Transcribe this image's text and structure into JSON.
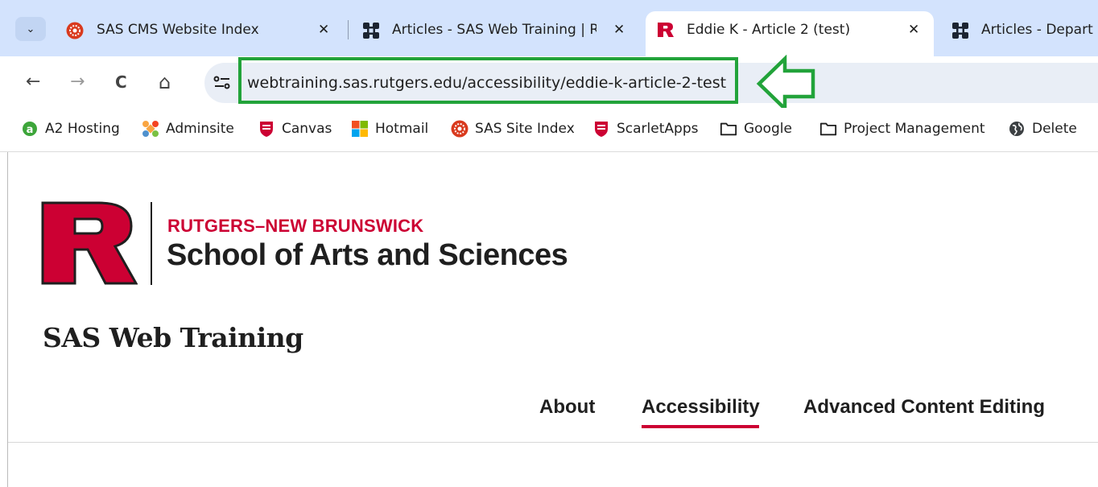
{
  "browser": {
    "tabs": [
      {
        "title": "SAS CMS Website Index",
        "icon": "sas-logo-icon",
        "close": "✕"
      },
      {
        "title": "Articles - SAS Web Training | Ru",
        "icon": "joomla-icon",
        "close": "✕"
      },
      {
        "title": "Eddie K - Article 2 (test)",
        "icon": "rutgers-r-icon",
        "close": "✕",
        "active": true
      },
      {
        "title": "Articles - Depart",
        "icon": "joomla-icon"
      }
    ],
    "tab_dropdown": "⌄",
    "nav": {
      "back": "←",
      "forward": "→",
      "reload": "C",
      "home": "⌂"
    },
    "url": "webtraining.sas.rutgers.edu/accessibility/eddie-k-article-2-test",
    "annotation_color": "#22a33a",
    "bookmarks": [
      {
        "label": "A2 Hosting",
        "icon": "a2-hosting-icon"
      },
      {
        "label": "Adminsite",
        "icon": "joomla-icon"
      },
      {
        "label": "Canvas",
        "icon": "rutgers-shield-icon"
      },
      {
        "label": "Hotmail",
        "icon": "windows-icon"
      },
      {
        "label": "SAS Site Index",
        "icon": "sas-logo-icon"
      },
      {
        "label": "ScarletApps",
        "icon": "rutgers-shield-icon"
      },
      {
        "label": "Google",
        "icon": "folder-icon"
      },
      {
        "label": "Project Management",
        "icon": "folder-icon"
      },
      {
        "label": "Delete",
        "icon": "globe-icon"
      }
    ]
  },
  "page": {
    "org_line1": "RUTGERS–NEW BRUNSWICK",
    "org_line2": "School of Arts and Sciences",
    "site_title": "SAS Web Training",
    "nav": [
      {
        "label": "About"
      },
      {
        "label": "Accessibility",
        "active": true
      },
      {
        "label": "Advanced Content Editing"
      }
    ],
    "brand_color": "#cc0033"
  }
}
